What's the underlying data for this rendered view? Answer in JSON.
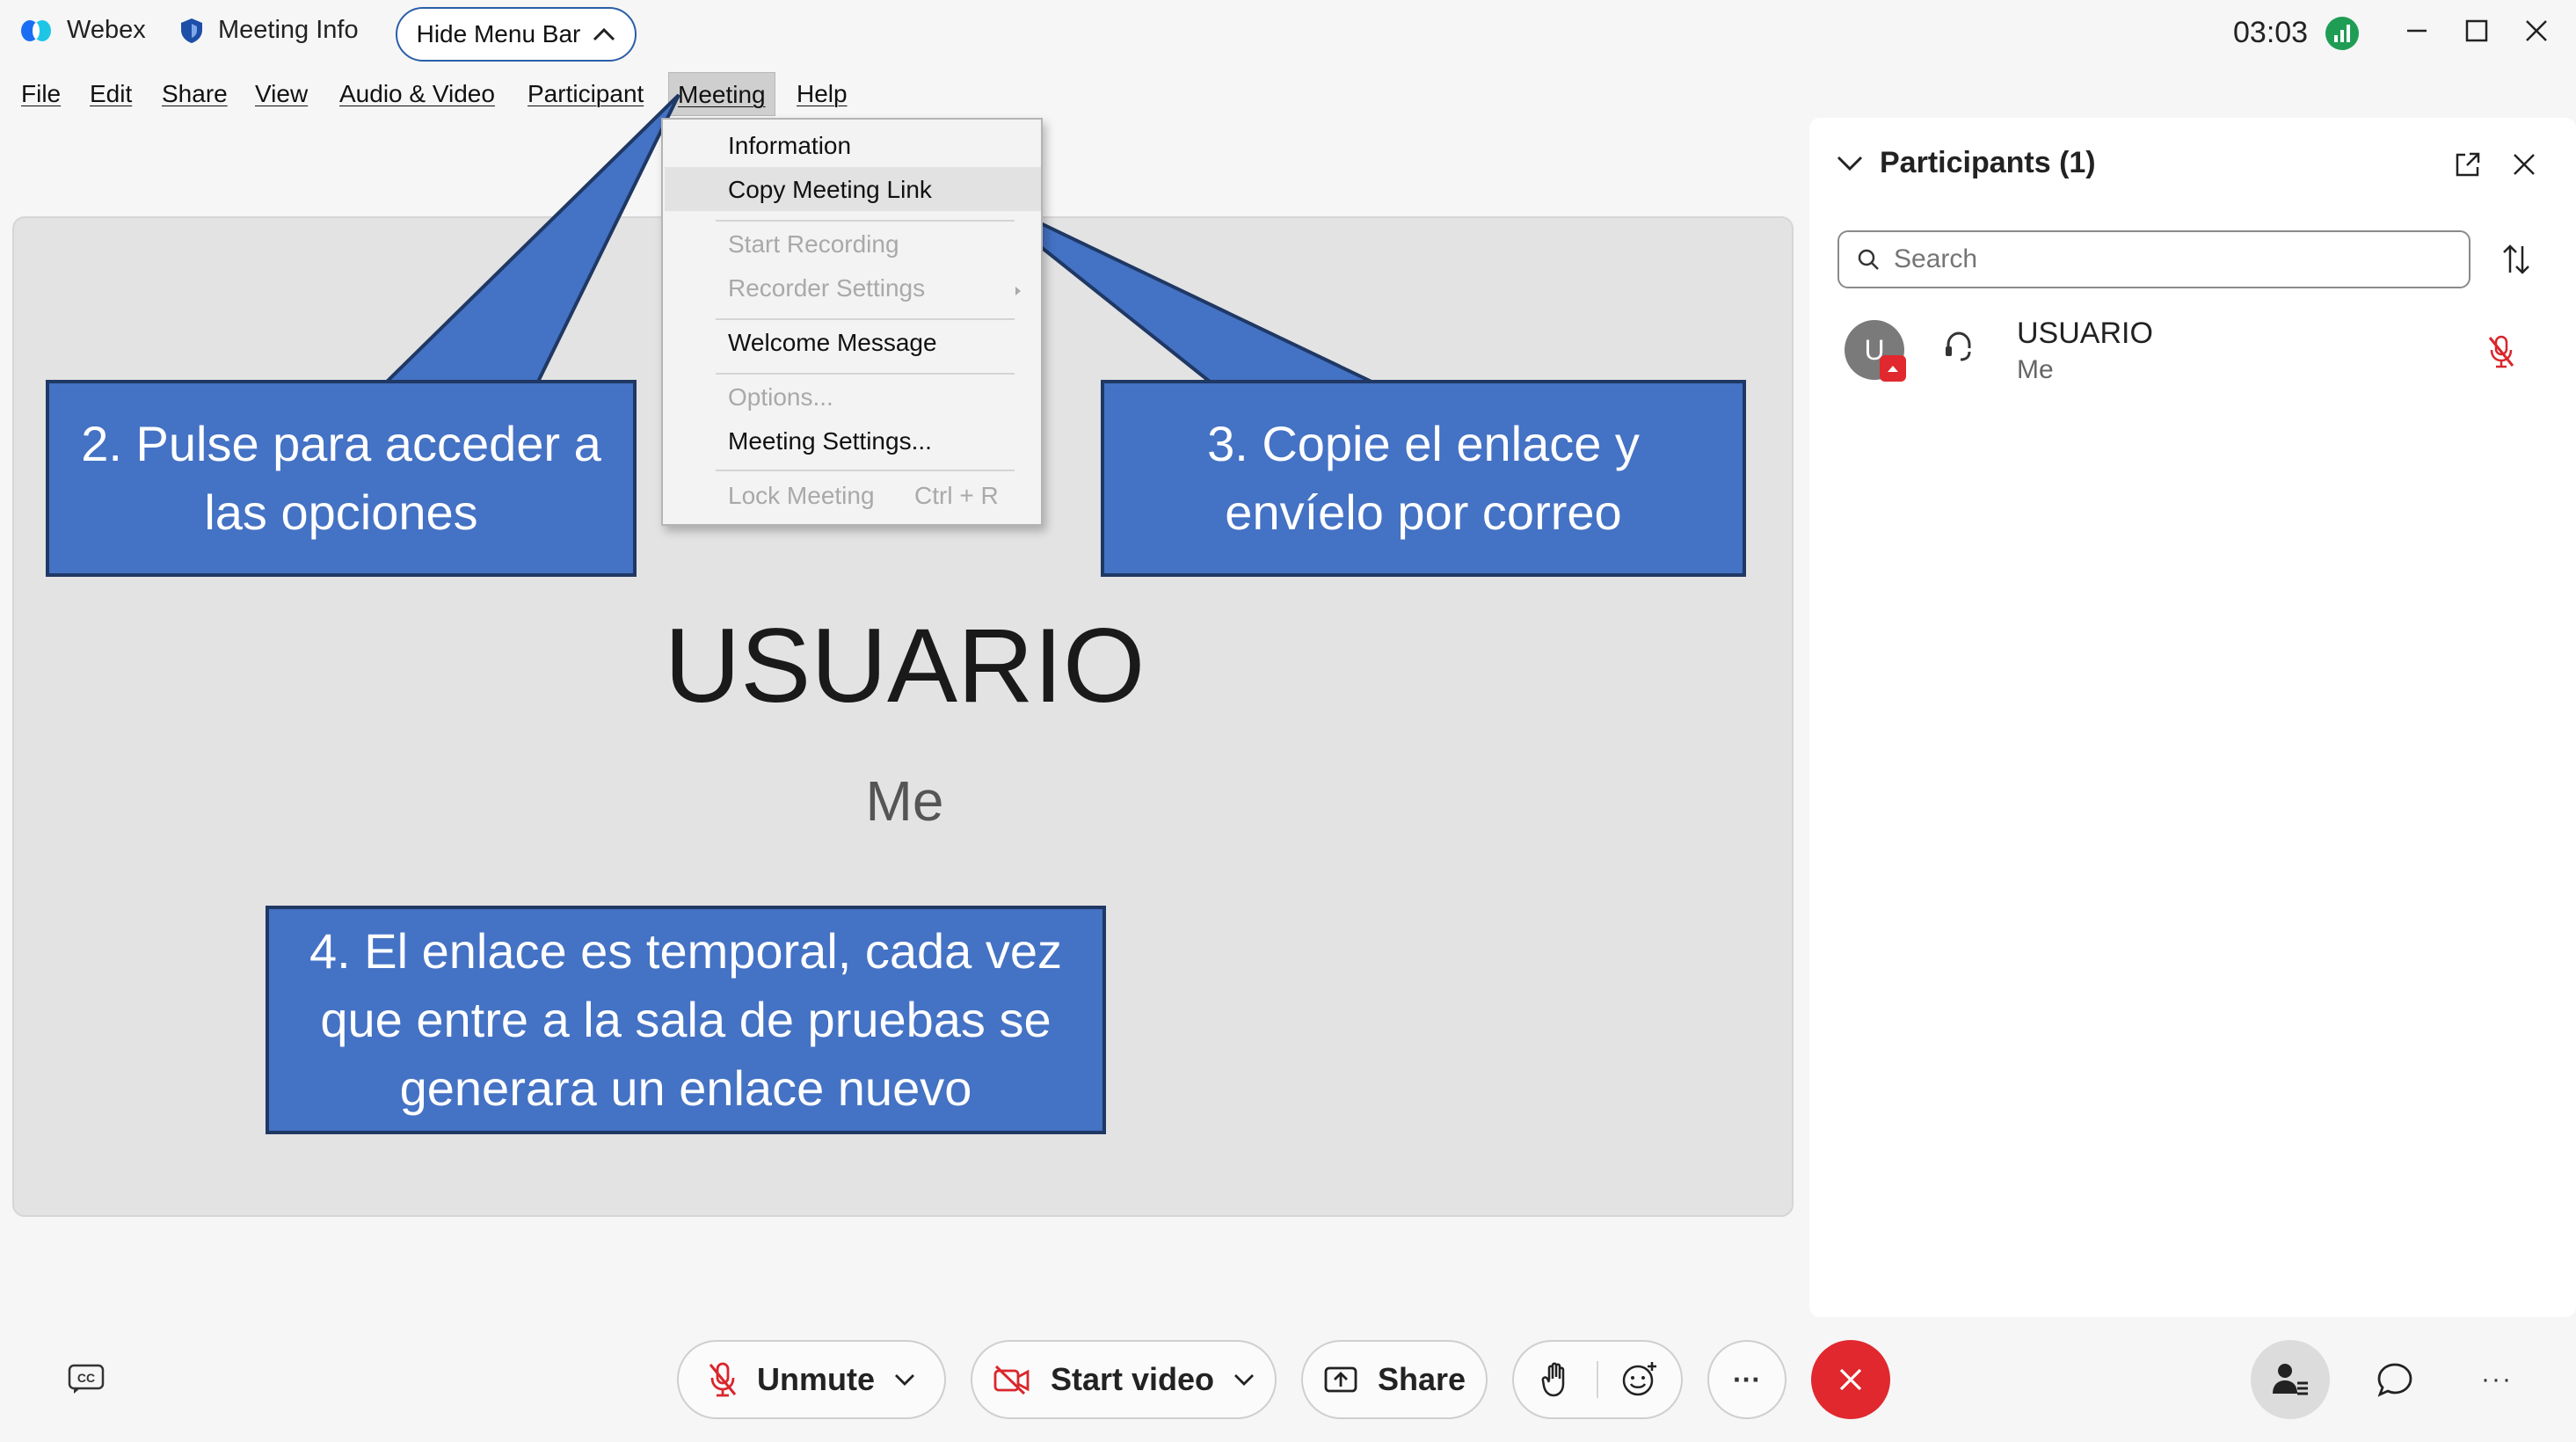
{
  "titlebar": {
    "app_name": "Webex",
    "meeting_info": "Meeting Info",
    "hide_menu_bar": "Hide Menu Bar",
    "time": "03:03"
  },
  "menubar": {
    "items": [
      "File",
      "Edit",
      "Share",
      "View",
      "Audio & Video",
      "Participant",
      "Meeting",
      "Help"
    ]
  },
  "meeting_menu": {
    "information": "Information",
    "copy_link": "Copy Meeting Link",
    "start_recording": "Start Recording",
    "recorder_settings": "Recorder Settings",
    "welcome_message": "Welcome Message",
    "options": "Options...",
    "meeting_settings": "Meeting Settings...",
    "lock_meeting": "Lock Meeting",
    "lock_shortcut": "Ctrl + R"
  },
  "callouts": {
    "step2_line1": "2. Pulse para acceder a",
    "step2_line2": "las opciones",
    "step3_line1": "3. Copie el enlace y",
    "step3_line2": "envíelo por correo",
    "step4_line1": "4. El enlace es temporal, cada vez",
    "step4_line2": "que entre a la sala de pruebas se",
    "step4_line3": "generara un enlace nuevo"
  },
  "stage": {
    "name": "USUARIO",
    "subtitle": "Me"
  },
  "participants": {
    "title": "Participants (1)",
    "search_placeholder": "Search",
    "list": [
      {
        "name": "USUARIO",
        "role": "Me",
        "avatar_letter": "U"
      }
    ]
  },
  "controls": {
    "unmute": "Unmute",
    "start_video": "Start video",
    "share": "Share",
    "more": "···"
  },
  "colors": {
    "callout_fill": "#4472c4",
    "callout_border": "#1f3864",
    "end_call": "#e0282e",
    "muted_red": "#d9262c",
    "accent_blue": "#2a5ea8"
  }
}
